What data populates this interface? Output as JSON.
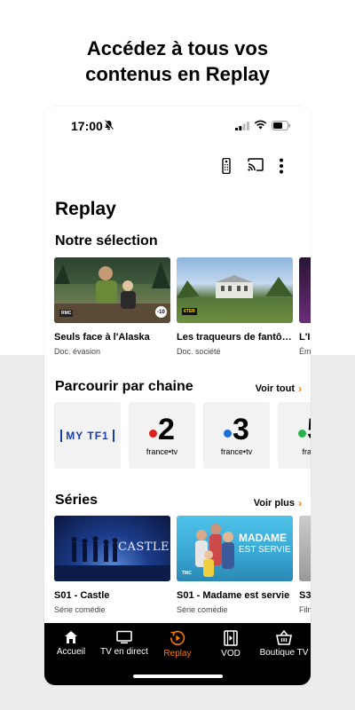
{
  "headline": {
    "line1": "Accédez à tous vos",
    "line2": "contenus en Replay"
  },
  "status_bar": {
    "time": "17:00",
    "icons": [
      "bell-muted-icon",
      "signal-icon",
      "wifi-icon",
      "battery-icon"
    ]
  },
  "top_actions": [
    "remote-icon",
    "cast-icon",
    "more-vert-icon"
  ],
  "page_title": "Replay",
  "selection": {
    "title": "Notre sélection",
    "items": [
      {
        "title": "Seuls face à l'Alaska",
        "subtitle": "Doc. évasion",
        "channel_badge": "RMC",
        "rating_badge": "-10"
      },
      {
        "title": "Les traqueurs de fantô…",
        "subtitle": "Doc. société",
        "channel_badge": "6TER"
      },
      {
        "title": "L'I",
        "subtitle": "Ém"
      }
    ]
  },
  "channels": {
    "title": "Parcourir par chaine",
    "link": "Voir tout",
    "items": [
      {
        "name": "MY TF1"
      },
      {
        "number": "2",
        "brand": "france•tv",
        "dot_color": "#e0201c"
      },
      {
        "number": "3",
        "brand": "france•tv",
        "dot_color": "#1d6fd8"
      },
      {
        "number": "5",
        "brand": "franc",
        "dot_color": "#26b24b"
      }
    ]
  },
  "series": {
    "title": "Séries",
    "link": "Voir plus",
    "items": [
      {
        "title": "S01 - Castle",
        "subtitle": "Série comédie",
        "logo_text": "CASTLE"
      },
      {
        "title": "S01 - Madame est servie",
        "subtitle": "Série comédie",
        "logo_line1": "MADAME",
        "logo_line2": "EST SERVIE",
        "channel_badge": "TMC"
      },
      {
        "title": "S3",
        "subtitle": "Film"
      }
    ]
  },
  "tabbar": {
    "items": [
      {
        "label": "Accueil",
        "icon": "home-icon"
      },
      {
        "label": "TV en direct",
        "icon": "tv-icon"
      },
      {
        "label": "Replay",
        "icon": "replay-icon",
        "active": true
      },
      {
        "label": "VOD",
        "icon": "film-icon"
      },
      {
        "label": "Boutique TV",
        "icon": "basket-icon"
      }
    ]
  },
  "colors": {
    "accent": "#ff7900",
    "tabbar_bg": "#000000",
    "page_lower_bg": "#ededed"
  }
}
